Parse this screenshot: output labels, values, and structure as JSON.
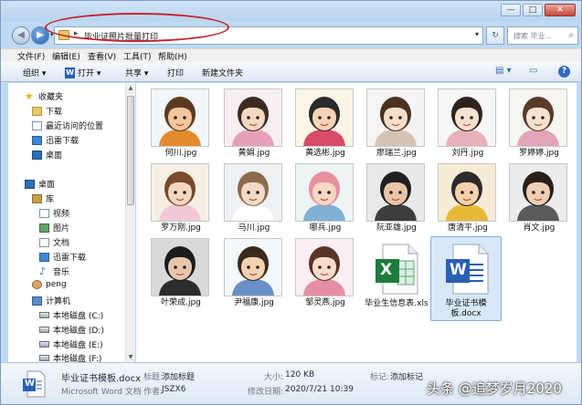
{
  "window_controls": {
    "minimize": "—",
    "maximize": "□",
    "close": "✕"
  },
  "nav": {
    "back_glyph": "◀",
    "forward_glyph": "▶",
    "dropdown_glyph": "▾"
  },
  "address": {
    "separator": "▸",
    "path": "毕业证照片批量打印",
    "dropdown_glyph": "▾",
    "refresh_glyph": "↻"
  },
  "search": {
    "placeholder": "搜索 毕业...",
    "icon": "⌕"
  },
  "menu": [
    "文件(F)",
    "编辑(E)",
    "查看(V)",
    "工具(T)",
    "帮助(H)"
  ],
  "toolbar": {
    "organize": "组织 ▾",
    "open": "打开 ▾",
    "share": "共享 ▾",
    "print": "打印",
    "new_folder": "新建文件夹",
    "help": "?"
  },
  "sidebar": {
    "favorites": "收藏夹",
    "downloads": "下载",
    "recent": "最近访问的位置",
    "thunder": "迅雷下载",
    "desktop_fav": "桌面",
    "desktop": "桌面",
    "library": "库",
    "videos": "视频",
    "pictures": "图片",
    "documents": "文档",
    "thunder2": "迅雷下载",
    "music": "音乐",
    "user": "peng",
    "computer": "计算机",
    "disk_c": "本地磁盘 (C:)",
    "disk_d": "本地磁盘 (D:)",
    "disk_e": "本地磁盘 (E:)",
    "disk_f": "本地磁盘 (F:)"
  },
  "files": [
    {
      "name": "何川.jpg",
      "bg": "#f2f6fb",
      "skin": "#f4c79c",
      "hair": "#5b3a22",
      "shirt": "#e28a2d"
    },
    {
      "name": "黄娟.jpg",
      "bg": "#f7eef3",
      "skin": "#f7d9c2",
      "hair": "#3b2b22",
      "shirt": "#e7a1b7"
    },
    {
      "name": "黄选彬.jpg",
      "bg": "#fbf5e8",
      "skin": "#f5d3b4",
      "hair": "#2a2a2a",
      "shirt": "#d84a6a"
    },
    {
      "name": "廖瑞兰.jpg",
      "bg": "#f4f4f4",
      "skin": "#f8dfcb",
      "hair": "#4a3222",
      "shirt": "#d7c3b3"
    },
    {
      "name": "刘丹.jpg",
      "bg": "#f6f6f6",
      "skin": "#f9e1cf",
      "hair": "#2f221b",
      "shirt": "#e8b0b8"
    },
    {
      "name": "罗婷婷.jpg",
      "bg": "#f3f7f0",
      "skin": "#f9e2cf",
      "hair": "#5a3a28",
      "shirt": "#e3a3b8"
    },
    {
      "name": "罗万刚.jpg",
      "bg": "#f6f0e4",
      "skin": "#f5d8c1",
      "hair": "#7a4a2e",
      "shirt": "#f0c8d4"
    },
    {
      "name": "马川.jpg",
      "bg": "#eef1f4",
      "skin": "#f2dac6",
      "hair": "#8c6a4a",
      "shirt": "#ffffff"
    },
    {
      "name": "哪兵.jpg",
      "bg": "#eef4f3",
      "skin": "#f6d8c3",
      "hair": "#e88fa0",
      "shirt": "#7fb1d6"
    },
    {
      "name": "阮亚雄.jpg",
      "bg": "#e9e9e9",
      "skin": "#e9c5a6",
      "hair": "#1f1f1f",
      "shirt": "#3d3d3d"
    },
    {
      "name": "唐清平.jpg",
      "bg": "#f7ecd6",
      "skin": "#f4d1ad",
      "hair": "#2b2b2b",
      "shirt": "#e8b936"
    },
    {
      "name": "肖文.jpg",
      "bg": "#ececec",
      "skin": "#edcfb4",
      "hair": "#2a1f18",
      "shirt": "#5a5a5a"
    },
    {
      "name": "叶荣成.jpg",
      "bg": "#d9d9d9",
      "skin": "#e6c7ad",
      "hair": "#1c1c1c",
      "shirt": "#2c2c2c"
    },
    {
      "name": "尹福康.jpg",
      "bg": "#f5f8fb",
      "skin": "#f4d2b1",
      "hair": "#3a2a1e",
      "shirt": "#6b8fc7"
    },
    {
      "name": "邹灵燕.jpg",
      "bg": "#fbeff3",
      "skin": "#f8dccb",
      "hair": "#5a3427",
      "shirt": "#e58ea3"
    }
  ],
  "excel_file": {
    "name": "毕业生信息表.xls",
    "glyph": "X"
  },
  "word_file": {
    "name": "毕业证书模板.docx",
    "glyph": "W"
  },
  "details": {
    "filename": "毕业证书模板.docx",
    "filetype": "Microsoft Word 文档",
    "title_label": "标题:",
    "title_value": "添加标题",
    "author_label": "作者:",
    "author_value": "JSZX6",
    "size_label": "大小:",
    "size_value": "120 KB",
    "modified_label": "修改日期:",
    "modified_value": "2020/7/21 10:39",
    "tags_label": "标记:",
    "tags_value": "添加标记"
  },
  "watermark": "头条 @追梦岁月2020",
  "colors": {
    "accent": "#2b5fb4",
    "highlight_oval": "#c3252e",
    "selection": "#d7e8fa",
    "excel": "#1f7a3d"
  }
}
